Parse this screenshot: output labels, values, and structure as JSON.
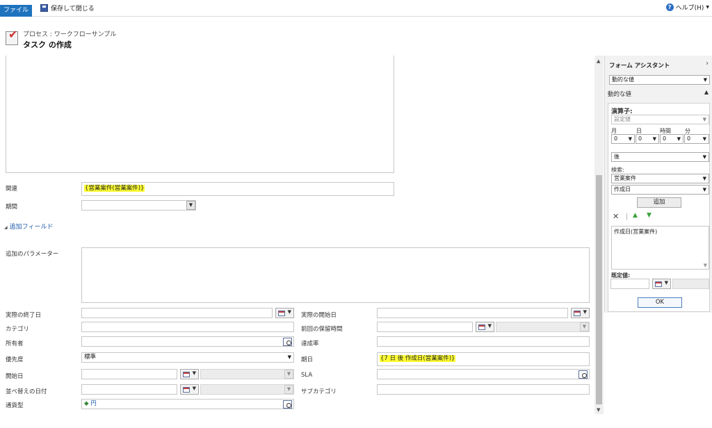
{
  "ribbon": {
    "file_tab": "ファイル",
    "save_close": "保存して閉じる",
    "help": "ヘルプ(H)"
  },
  "header": {
    "breadcrumb": "プロセス : ワークフローサンプル",
    "title": "タスク の作成"
  },
  "form": {
    "related_label": "関連",
    "related_value": "{営業案件(営業案件)}",
    "duration_label": "期間",
    "section_link": "追加フィールド",
    "params_label": "追加のパラメーター",
    "actual_end_label": "実際の終了日",
    "actual_start_label": "実際の開始日",
    "category_label": "カテゴリ",
    "last_onhold_label": "前回の保留時間",
    "owner_label": "所有者",
    "completion_label": "達成率",
    "priority_label": "優先度",
    "priority_value": "標準",
    "due_label": "期日",
    "due_value": "{7 日 後 作成日(営業案件)}",
    "start_label": "開始日",
    "sla_label": "SLA",
    "sort_date_label": "並べ替えの日付",
    "subcategory_label": "サブカテゴリ",
    "currency_label": "通貨型",
    "currency_value": "円"
  },
  "panel": {
    "title": "フォーム アシスタント",
    "dynamic_select": "動的な値",
    "dynamic_header": "動的な値",
    "operator_label": "演算子:",
    "operator_value": "設定値",
    "month_label": "月",
    "day_label": "日",
    "hour_label": "時間",
    "minute_label": "分",
    "month_value": "0",
    "day_value": "0",
    "hour_value": "0",
    "minute_value": "0",
    "after_value": "後",
    "search_label": "検索:",
    "entity_value": "営業案件",
    "field_value": "作成日",
    "add_button": "追加",
    "list_item": "作成日(営業案件)",
    "default_label": "既定値:",
    "ok_button": "OK"
  }
}
